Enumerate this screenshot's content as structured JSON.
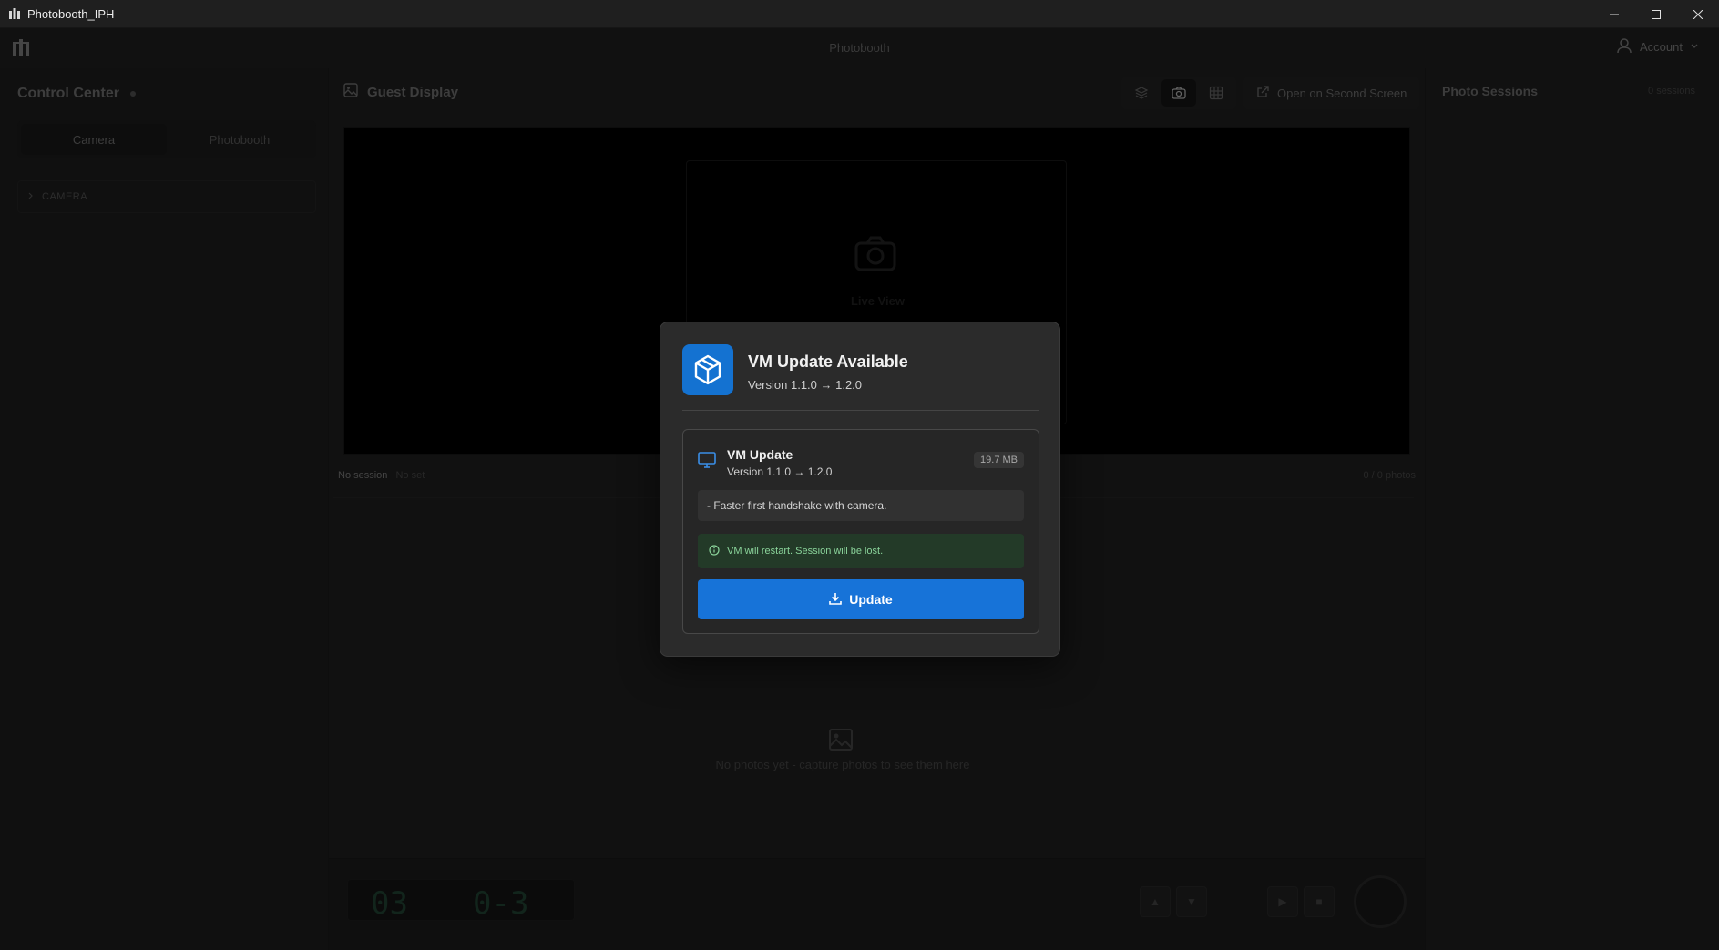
{
  "window": {
    "title": "Photobooth_IPH"
  },
  "header": {
    "center_title": "Photobooth",
    "account_label": "Account"
  },
  "left": {
    "title": "Control Center",
    "tabs": [
      {
        "label": "Camera"
      },
      {
        "label": "Photobooth"
      }
    ],
    "camera_section": "CAMERA"
  },
  "center": {
    "title": "Guest Display",
    "open_second_screen": "Open on Second Screen",
    "live_view_label": "Live View",
    "session_name": "No session",
    "session_set": "No set",
    "photo_count": "0 / 0 photos",
    "empty_gallery": "No photos yet - capture photos to see them here",
    "counter": {
      "left": "03",
      "right": "0-3"
    }
  },
  "right": {
    "title": "Photo Sessions",
    "count": "0 sessions"
  },
  "modal": {
    "title": "VM Update Available",
    "subtitle": "Version 1.1.0 → 1.2.0",
    "item": {
      "name": "VM Update",
      "version": "Version 1.1.0 → 1.2.0",
      "size": "19.7 MB",
      "notes": "- Faster first handshake with camera.",
      "warning": "VM will restart. Session will be lost."
    },
    "button_label": "Update",
    "accent_color": "#1773d8"
  }
}
